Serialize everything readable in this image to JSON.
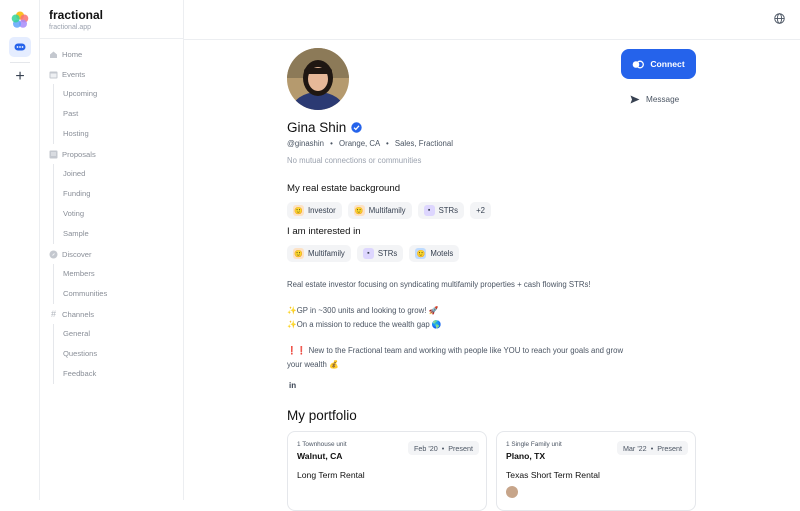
{
  "app": {
    "name": "fractional",
    "url": "fractional.app"
  },
  "sidebar": {
    "sections": [
      {
        "label": "Home",
        "icon": "home-icon",
        "children": []
      },
      {
        "label": "Events",
        "icon": "calendar-icon",
        "children": [
          "Upcoming",
          "Past",
          "Hosting"
        ]
      },
      {
        "label": "Proposals",
        "icon": "document-icon",
        "children": [
          "Joined",
          "Funding",
          "Voting",
          "Sample"
        ]
      },
      {
        "label": "Discover",
        "icon": "compass-icon",
        "children": [
          "Members",
          "Communities"
        ]
      },
      {
        "label": "Channels",
        "icon": "hash-icon",
        "children": [
          "General",
          "Questions",
          "Feedback"
        ]
      }
    ]
  },
  "profile": {
    "name": "Gina Shin",
    "handle": "@ginashin",
    "location": "Orange, CA",
    "role": "Sales, Fractional",
    "mutual": "No mutual connections or communities",
    "connect_label": "Connect",
    "message_label": "Message"
  },
  "background": {
    "title": "My real estate background",
    "chips": [
      {
        "label": "Investor",
        "icon": "investor-emoji-icon",
        "color": "#fde2c4"
      },
      {
        "label": "Multifamily",
        "icon": "multifamily-emoji-icon",
        "color": "#fde2c4"
      },
      {
        "label": "STRs",
        "icon": "str-emoji-icon",
        "color": "#ddd6fe"
      }
    ],
    "more": "+2"
  },
  "interests": {
    "title": "I am interested in",
    "chips": [
      {
        "label": "Multifamily",
        "icon": "multifamily-emoji-icon",
        "color": "#fde2c4"
      },
      {
        "label": "STRs",
        "icon": "str-emoji-icon",
        "color": "#ddd6fe"
      },
      {
        "label": "Motels",
        "icon": "motel-emoji-icon",
        "color": "#bfdbfe"
      }
    ]
  },
  "bio": {
    "line1": "Real estate investor focusing on syndicating multifamily properties + cash flowing STRs!",
    "line2": "✨GP in ~300 units and looking to grow! 🚀",
    "line3": "✨On a mission to reduce the wealth gap 🌎",
    "line4": "❗❗ New to the Fractional team and working with people like YOU to reach your goals and grow",
    "line5": "your wealth 💰",
    "linkedin": "in"
  },
  "portfolio": {
    "title": "My portfolio",
    "cards": [
      {
        "units": "1 Townhouse unit",
        "city": "Walnut, CA",
        "strategy": "Long Term Rental",
        "start": "Feb '20",
        "end": "Present"
      },
      {
        "units": "1 Single Family unit",
        "city": "Plano, TX",
        "strategy": "Texas Short Term Rental",
        "start": "Mar '22",
        "end": "Present"
      }
    ]
  },
  "colors": {
    "accent": "#2563eb",
    "verified": "#2563eb"
  }
}
